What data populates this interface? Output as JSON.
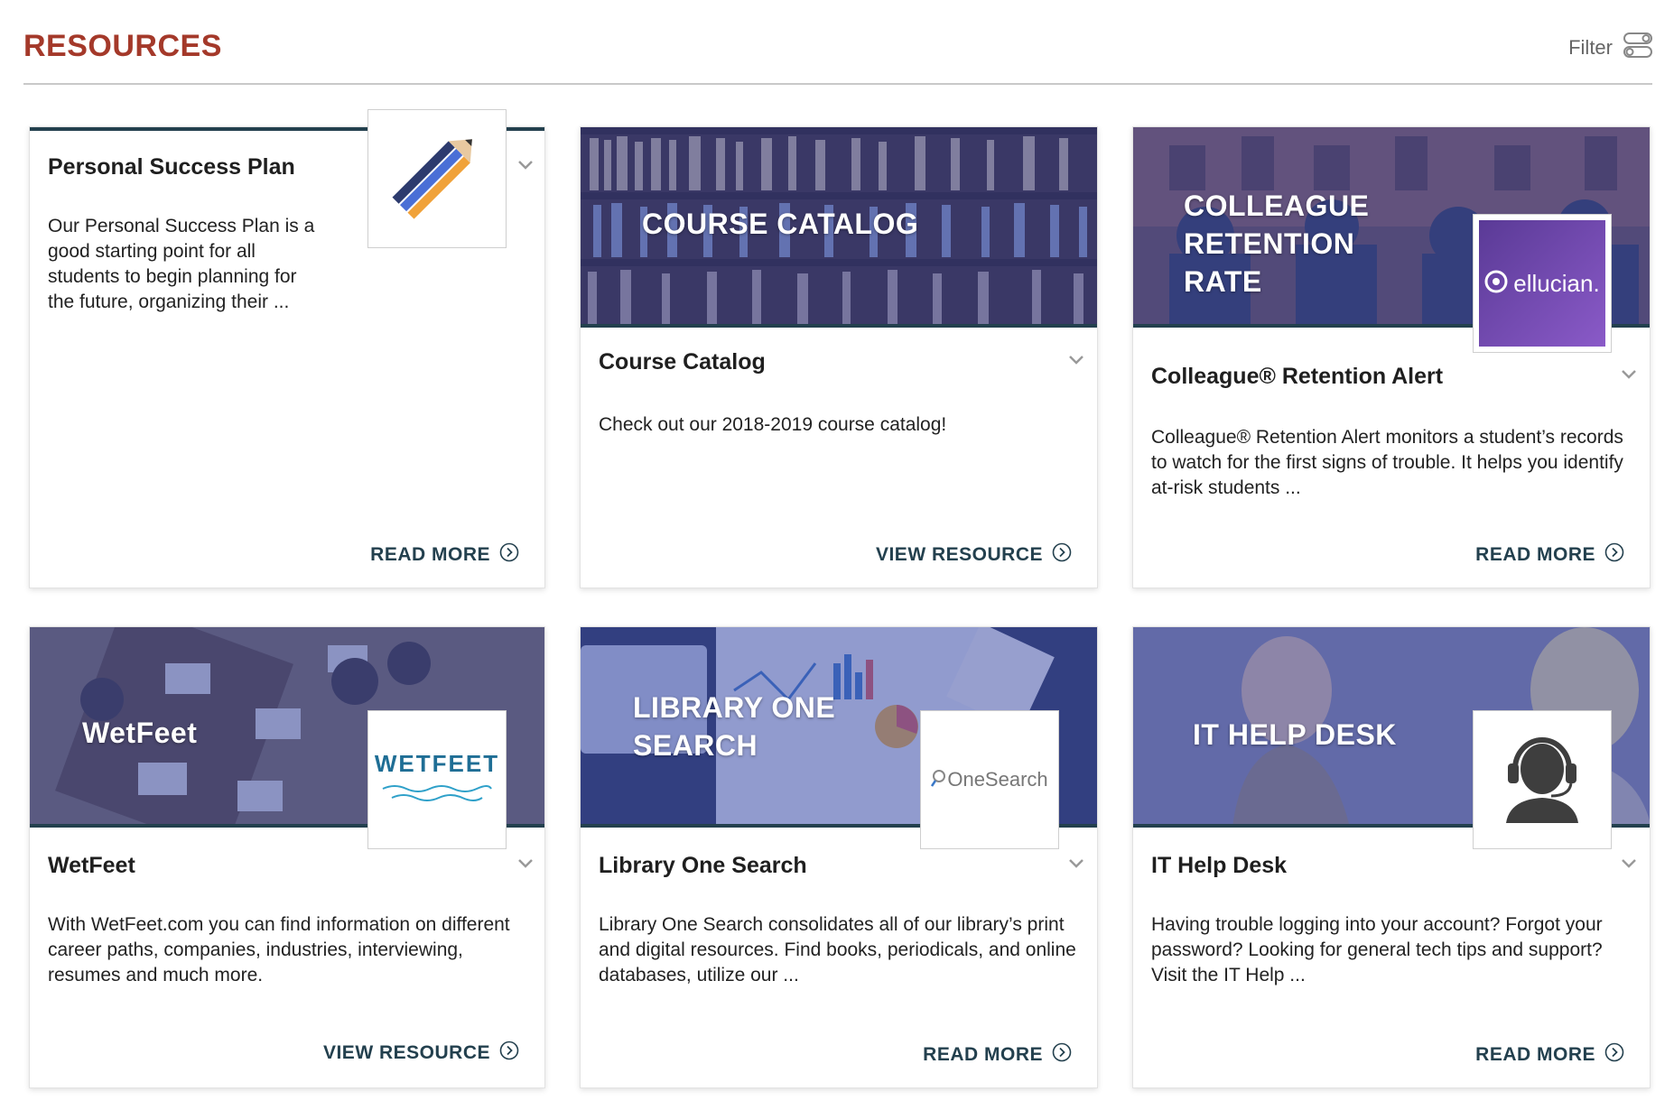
{
  "page": {
    "title": "RESOURCES",
    "filter_label": "Filter"
  },
  "colors": {
    "brand": "#a4392a",
    "accent": "#23404e",
    "overlay": "#3a4aa8"
  },
  "cards": [
    {
      "title": "Personal Success Plan",
      "description": "Our Personal Success Plan is a good starting point for all students to begin planning for the future, organizing their ...",
      "action": "READ MORE",
      "logo": "pencil-icon"
    },
    {
      "title": "Course Catalog",
      "banner_text": "COURSE CATALOG",
      "description": "Check out our 2018-2019 course catalog!",
      "action": "VIEW RESOURCE"
    },
    {
      "title": "Colleague® Retention Alert",
      "banner_text": "COLLEAGUE RETENTION RATE",
      "logo_text": "ellucian.",
      "description": "Colleague® Retention Alert monitors a student’s records to watch for the first signs of trouble. It helps you identify at-risk students ...",
      "action": "READ MORE"
    },
    {
      "title": "WetFeet",
      "banner_text": "WetFeet",
      "logo_text": "WETFEET",
      "description": "With WetFeet.com you can find information on different career paths, companies, industries, interviewing, resumes and much more.",
      "action": "VIEW RESOURCE"
    },
    {
      "title": "Library One Search",
      "banner_text": "LIBRARY ONE SEARCH",
      "logo_text": "OneSearch",
      "description": "Library One Search consolidates all of our library’s print and digital resources. Find books, periodicals, and online databases, utilize our ...",
      "action": "READ MORE"
    },
    {
      "title": "IT Help Desk",
      "banner_text": "IT HELP DESK",
      "logo": "headset-support-icon",
      "description": "Having trouble logging into your account? Forgot your password? Looking for general tech tips and support? Visit the IT Help ...",
      "action": "READ MORE"
    }
  ]
}
